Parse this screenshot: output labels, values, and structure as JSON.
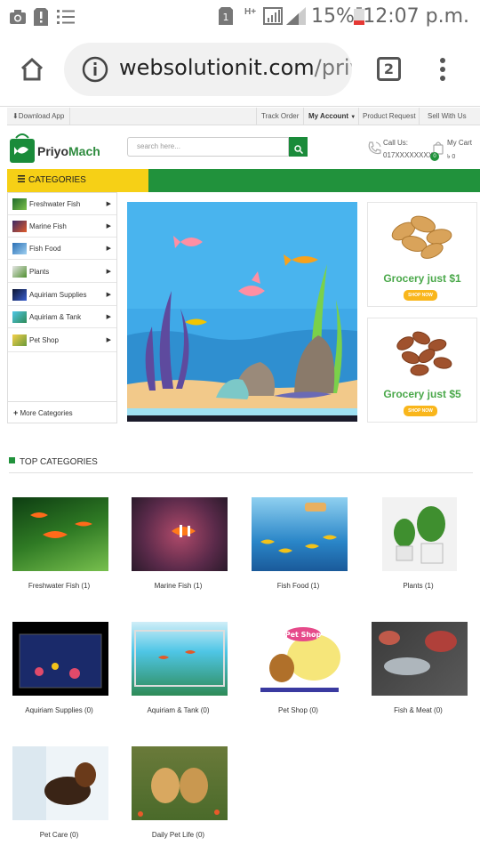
{
  "status_bar": {
    "battery_pct": "15%",
    "time": "12:07 p.m.",
    "network": "H+"
  },
  "browser": {
    "url_host": "websolutionit.com",
    "url_path": "/priy",
    "tab_count": "2"
  },
  "topbar": {
    "download_app": "Download App",
    "links": [
      "Track Order",
      "My Account",
      "Product Request",
      "Sell With Us"
    ]
  },
  "header": {
    "logo_part1": "Priyo",
    "logo_part2": "Mach",
    "search_placeholder": "search here...",
    "call_us_label": "Call Us:",
    "phone": "017XXXXXXXX",
    "cart_label": "My Cart",
    "cart_count": "0",
    "cart_total": "৳ 0"
  },
  "nav": {
    "categories_label": "CATEGORIES"
  },
  "side_menu": {
    "items": [
      {
        "label": "Freshwater Fish"
      },
      {
        "label": "Marine Fish"
      },
      {
        "label": "Fish Food"
      },
      {
        "label": "Plants"
      },
      {
        "label": "Aquiriam Supplies"
      },
      {
        "label": "Aquiriam & Tank"
      },
      {
        "label": "Pet Shop"
      }
    ],
    "more": "More Categories"
  },
  "ads": [
    {
      "text": "Grocery just $1",
      "button": "SHOP NOW"
    },
    {
      "text": "Grocery just $5",
      "button": "SHOP NOW"
    }
  ],
  "top_categories": {
    "title": "TOP CATEGORIES",
    "items": [
      {
        "label": "Freshwater Fish (1)"
      },
      {
        "label": "Marine Fish (1)"
      },
      {
        "label": "Fish Food (1)"
      },
      {
        "label": "Plants (1)"
      },
      {
        "label": "Aquiriam Supplies (0)"
      },
      {
        "label": "Aquiriam & Tank (0)"
      },
      {
        "label": "Pet Shop (0)"
      },
      {
        "label": "Fish & Meat (0)"
      },
      {
        "label": "Pet Care (0)"
      },
      {
        "label": "Daily Pet Life (0)"
      }
    ],
    "pet_shop_logo_text": "Pet Shop"
  },
  "colors": {
    "brand_green": "#21923c",
    "accent_yellow": "#f6d016"
  }
}
